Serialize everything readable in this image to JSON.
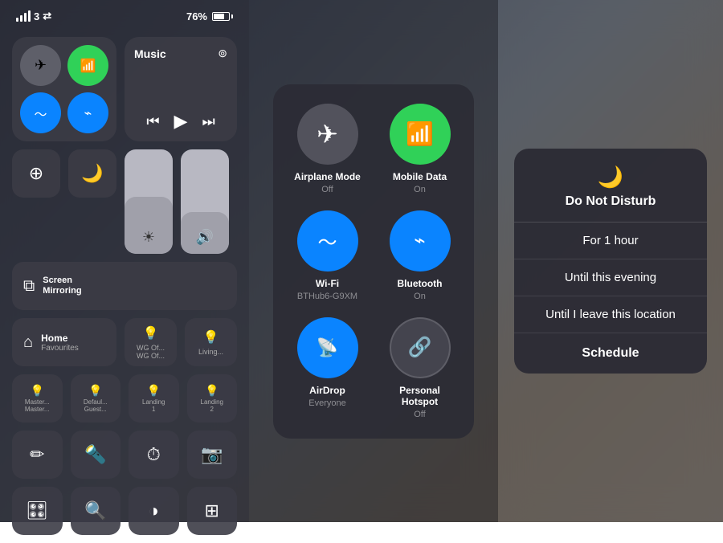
{
  "status": {
    "signal": "3",
    "wifi": true,
    "battery_pct": "76%",
    "carrier": "3"
  },
  "left_panel": {
    "connectivity": {
      "airplane": {
        "active": false,
        "label": "airplane"
      },
      "mobile_data": {
        "active": true,
        "label": "mobile_data"
      },
      "wifi": {
        "active": true,
        "label": "wifi"
      },
      "bluetooth": {
        "active": true,
        "label": "bluetooth"
      }
    },
    "music": {
      "title": "Music",
      "prev_label": "⏮",
      "play_label": "▶",
      "next_label": "⏭"
    },
    "screen_lock_label": "Screen\nLock",
    "do_not_disturb_label": "Do Not\nDisturb",
    "screen_mirroring_label": "Screen\nMirroring",
    "home_label": "Home",
    "home_sub": "Favourites",
    "lights": [
      {
        "label": "WG Of...\nWG Of..."
      },
      {
        "label": "Living..."
      }
    ],
    "scenes": [
      {
        "label": "Master...\nMaster..."
      },
      {
        "label": "Defaul...\nGuest..."
      },
      {
        "label": "Landing\n1"
      },
      {
        "label": "Landing\n2"
      }
    ],
    "bottom_tools": [
      "✏️",
      "🔦",
      "⏱",
      "📷"
    ],
    "bottom_tools2": [
      "🎛",
      "🔍",
      "◐",
      "⊞"
    ]
  },
  "mid_panel": {
    "items": [
      {
        "name": "airplane-mode",
        "label": "Airplane Mode",
        "sublabel": "Off",
        "icon": "✈",
        "state": "inactive"
      },
      {
        "name": "mobile-data",
        "label": "Mobile Data",
        "sublabel": "On",
        "icon": "📶",
        "state": "active-green"
      },
      {
        "name": "wifi",
        "label": "Wi-Fi",
        "sublabel": "BTHub6-G9XM",
        "icon": "📶",
        "state": "active-blue"
      },
      {
        "name": "bluetooth",
        "label": "Bluetooth",
        "sublabel": "On",
        "icon": "🦷",
        "state": "active-blue"
      },
      {
        "name": "airdrop",
        "label": "AirDrop",
        "sublabel": "Everyone",
        "icon": "📡",
        "state": "active-blue"
      },
      {
        "name": "personal-hotspot",
        "label": "Personal Hotspot",
        "sublabel": "Off",
        "icon": "🔗",
        "state": "inactive"
      }
    ]
  },
  "right_panel": {
    "title": "Do Not Disturb",
    "moon_icon": "🌙",
    "options": [
      {
        "label": "For 1 hour"
      },
      {
        "label": "Until this evening"
      },
      {
        "label": "Until I leave this location"
      }
    ],
    "schedule_label": "Schedule"
  }
}
